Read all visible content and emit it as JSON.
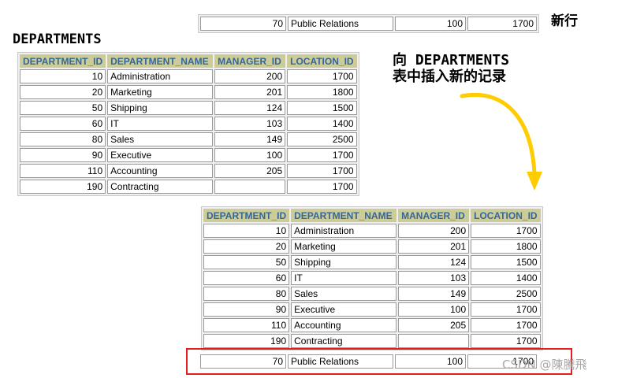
{
  "new_row_label": "新行",
  "table_title": "DEPARTMENTS",
  "insert_note": {
    "line1": "向 DEPARTMENTS",
    "line2": "表中插入新的记录"
  },
  "headers": [
    "DEPARTMENT_ID",
    "DEPARTMENT_NAME",
    "MANAGER_ID",
    "LOCATION_ID"
  ],
  "rows": [
    [
      "10",
      "Administration",
      "200",
      "1700"
    ],
    [
      "20",
      "Marketing",
      "201",
      "1800"
    ],
    [
      "50",
      "Shipping",
      "124",
      "1500"
    ],
    [
      "60",
      "IT",
      "103",
      "1400"
    ],
    [
      "80",
      "Sales",
      "149",
      "2500"
    ],
    [
      "90",
      "Executive",
      "100",
      "1700"
    ],
    [
      "110",
      "Accounting",
      "205",
      "1700"
    ],
    [
      "190",
      "Contracting",
      "",
      "1700"
    ]
  ],
  "new_row": [
    "70",
    "Public Relations",
    "100",
    "1700"
  ],
  "watermark": "CSDN @陳騰飛",
  "colors": {
    "header_bg": "#cccc99",
    "header_text": "#336699",
    "arrow": "#ffcc00",
    "highlight_box": "#e02020"
  }
}
